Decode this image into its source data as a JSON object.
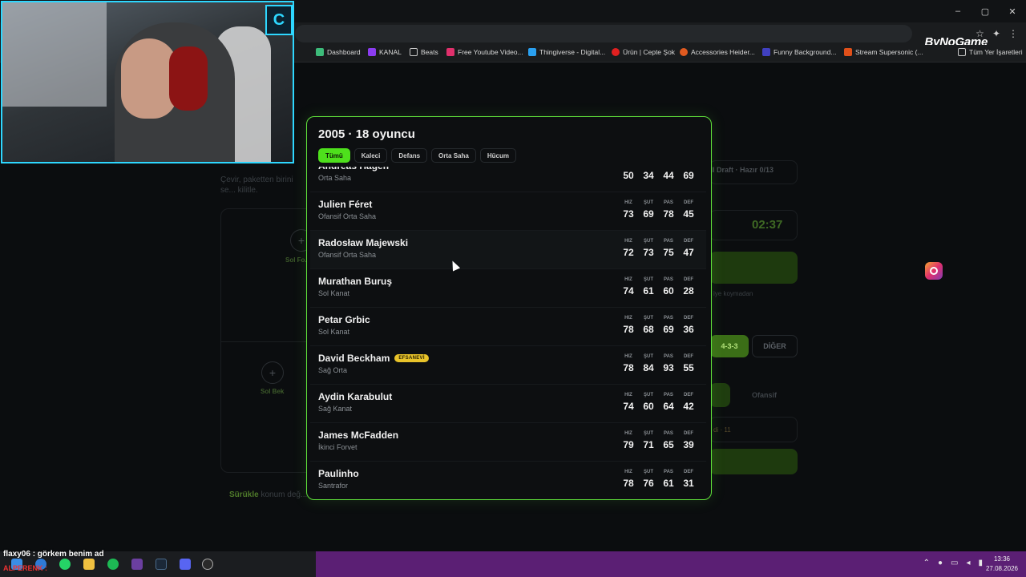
{
  "browser": {
    "bookmarks": [
      {
        "label": "Dashboard",
        "color": "#3dbb7a"
      },
      {
        "label": "KANAL",
        "color": "#8b3cf0"
      },
      {
        "label": "Beats",
        "color": "#c9c9c9"
      },
      {
        "label": "Free Youtube Video...",
        "color": "#e0306c"
      },
      {
        "label": "Thingiverse - Digital...",
        "color": "#2aa0f0"
      },
      {
        "label": "Ürün | Cepte Şok",
        "color": "#e02020"
      },
      {
        "label": "Accessories Heider...",
        "color": "#e05a20"
      },
      {
        "label": "Funny Background...",
        "color": "#4040c0"
      },
      {
        "label": "Stream Supersonic (...",
        "color": "#e0501a"
      },
      {
        "label": "Tüm Yer İşaretleri",
        "color": "#c9c9c9"
      }
    ],
    "brand": "ByNoGame",
    "window_controls": [
      "–",
      "▢",
      "✕"
    ]
  },
  "background": {
    "subtitle": "Çevir, paketten birini se... kilitle.",
    "slots": [
      {
        "label": "Sol Fo..."
      },
      {
        "label": "Sol Bek"
      }
    ],
    "drag_hint_bold": "Sürükle",
    "drag_hint_rest": " konum değ...",
    "draft_status": "ıll Draft · Hazır 0/13",
    "timer": "02:37",
    "note": "iye koymadan",
    "formation_selected": "4-3-3",
    "formation_other": "DİĞER",
    "style_other": "Ofansif",
    "count_hint": "di · 11"
  },
  "modal": {
    "title": "2005 · 18 oyuncu",
    "tabs": [
      {
        "label": "Tümü",
        "active": true
      },
      {
        "label": "Kaleci",
        "active": false
      },
      {
        "label": "Defans",
        "active": false
      },
      {
        "label": "Orta Saha",
        "active": false
      },
      {
        "label": "Hücum",
        "active": false
      }
    ],
    "stat_labels": [
      "HIZ",
      "ŞUT",
      "PAS",
      "DEF"
    ],
    "players": [
      {
        "name": "Andreas Hagen",
        "position": "Orta Saha",
        "badge": "",
        "stats": [
          50,
          34,
          44,
          69
        ]
      },
      {
        "name": "Julien Féret",
        "position": "Ofansif Orta Saha",
        "badge": "",
        "stats": [
          73,
          69,
          78,
          45
        ]
      },
      {
        "name": "Radosław Majewski",
        "position": "Ofansif Orta Saha",
        "badge": "",
        "stats": [
          72,
          73,
          75,
          47
        ]
      },
      {
        "name": "Murathan Buruş",
        "position": "Sol Kanat",
        "badge": "",
        "stats": [
          74,
          61,
          60,
          28
        ]
      },
      {
        "name": "Petar Grbic",
        "position": "Sol Kanat",
        "badge": "",
        "stats": [
          78,
          68,
          69,
          36
        ]
      },
      {
        "name": "David Beckham",
        "position": "Sağ Orta",
        "badge": "EFSANEVİ",
        "stats": [
          78,
          84,
          93,
          55
        ]
      },
      {
        "name": "Aydin Karabulut",
        "position": "Sağ Kanat",
        "badge": "",
        "stats": [
          74,
          60,
          64,
          42
        ]
      },
      {
        "name": "James McFadden",
        "position": "İkinci Forvet",
        "badge": "",
        "stats": [
          79,
          71,
          65,
          39
        ]
      },
      {
        "name": "Paulinho",
        "position": "Santrafor",
        "badge": "",
        "stats": [
          78,
          76,
          61,
          31
        ]
      }
    ]
  },
  "stream": {
    "chat_line": "flaxy06 : görkem benim ad",
    "chat_line2": "ALPERENK :"
  },
  "taskbar": {
    "time": "13:36",
    "date": "27.08.2026"
  }
}
